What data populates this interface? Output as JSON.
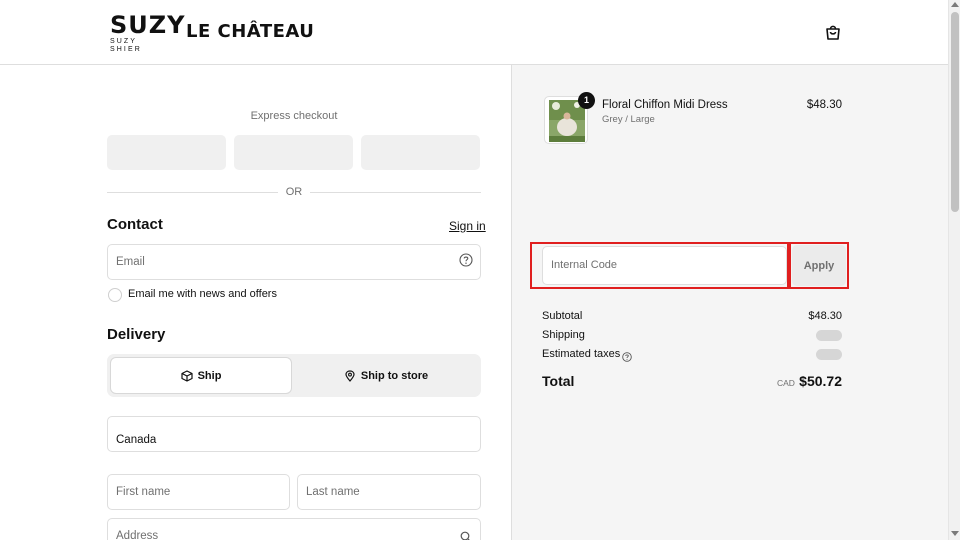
{
  "brand": {
    "suzy_logo": "SUZY",
    "suzy_tagline": "SUZY SHIER",
    "chateau_logo": "LE CHÂTEAU"
  },
  "header": {
    "cart_icon": "shopping-bag-icon"
  },
  "express": {
    "label": "Express checkout"
  },
  "divider": {
    "text": "OR"
  },
  "contact": {
    "heading": "Contact",
    "sign_in": "Sign in",
    "email_placeholder": "Email",
    "news_label": "Email me with news and offers"
  },
  "delivery": {
    "heading": "Delivery",
    "ship_label": "Ship",
    "ship_to_store_label": "Ship to store",
    "country_value": "Canada",
    "first_name_placeholder": "First name",
    "last_name_placeholder": "Last name",
    "address_placeholder": "Address"
  },
  "order": {
    "product_name": "Floral Chiffon Midi Dress",
    "product_variant": "Grey / Large",
    "product_price": "$48.30",
    "quantity": "1",
    "code_placeholder": "Internal Code",
    "apply_label": "Apply",
    "subtotal_label": "Subtotal",
    "subtotal_value": "$48.30",
    "shipping_label": "Shipping",
    "taxes_label": "Estimated taxes",
    "total_label": "Total",
    "total_currency": "CAD",
    "total_value": "$50.72"
  },
  "colors": {
    "highlight_outline": "#e01f1f",
    "summary_background": "#f5f5f5",
    "express_button": "#f0f0f0"
  }
}
